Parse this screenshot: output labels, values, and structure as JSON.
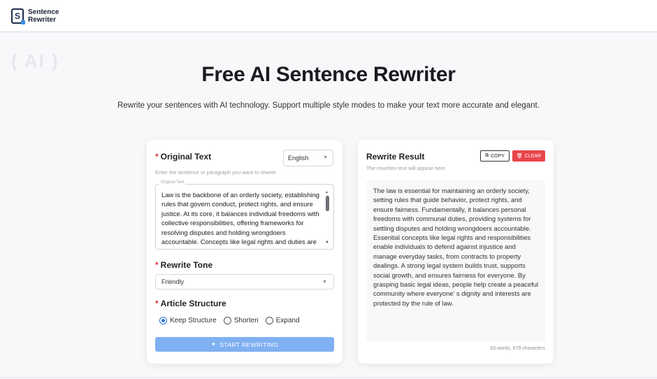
{
  "brand": {
    "line1": "Sentence",
    "line2": "Rewriter",
    "logo_letter": "S"
  },
  "ghost_text": "( AI )",
  "hero": {
    "title": "Free AI Sentence Rewriter",
    "subtitle": "Rewrite your sentences with AI technology. Support multiple style modes to make your text more accurate and elegant."
  },
  "input_panel": {
    "original_label": "Original Text",
    "required_mark": "*",
    "language": "English",
    "hint": "Enter the sentence or paragraph you want to rewrite",
    "field_label": "Original Text",
    "original_text": "Law is the backbone of an orderly society, establishing rules that govern conduct, protect rights, and ensure justice. At its core, it balances individual freedoms with collective responsibilities, offering frameworks for resolving disputes and holding wrongdoers accountable. Concepts like legal rights and duties are",
    "tone_label": "Rewrite Tone",
    "tone_value": "Friendly",
    "structure_label": "Article Structure",
    "structure_options": [
      "Keep Structure",
      "Shorten",
      "Expand"
    ],
    "structure_selected": "Keep Structure",
    "start_button": "START REWRITING"
  },
  "result_panel": {
    "title": "Rewrite Result",
    "hint": "The rewritten text will appear here",
    "copy_label": "COPY",
    "clear_label": "CLEAR",
    "result_text": "The law is essential for maintaining an orderly society, setting rules that guide behavior, protect rights, and ensure fairness. Fundamentally, it balances personal freedoms with communal duties, providing systems for settling disputes and holding wrongdoers accountable. Essential concepts like legal rights and responsibilities enable individuals to defend against injustice and manage everyday tasks, from contracts to property dealings. A strong legal system builds trust, supports social growth, and ensures fairness for everyone. By grasping basic legal ideas, people help create a peaceful community where everyone’ s dignity and interests are protected by the rule of law.",
    "counter": "93 words, 679 characters"
  },
  "colors": {
    "accent": "#2f6fd6",
    "start_button": "#7fb0f2",
    "clear_button": "#e9454b",
    "required": "#d9363e"
  },
  "icons": {
    "logo": "sentence-rewriter-logo-icon",
    "chevron": "chevron-down-icon",
    "sparkle": "sparkle-icon",
    "copy": "copy-icon",
    "trash": "trash-icon"
  }
}
